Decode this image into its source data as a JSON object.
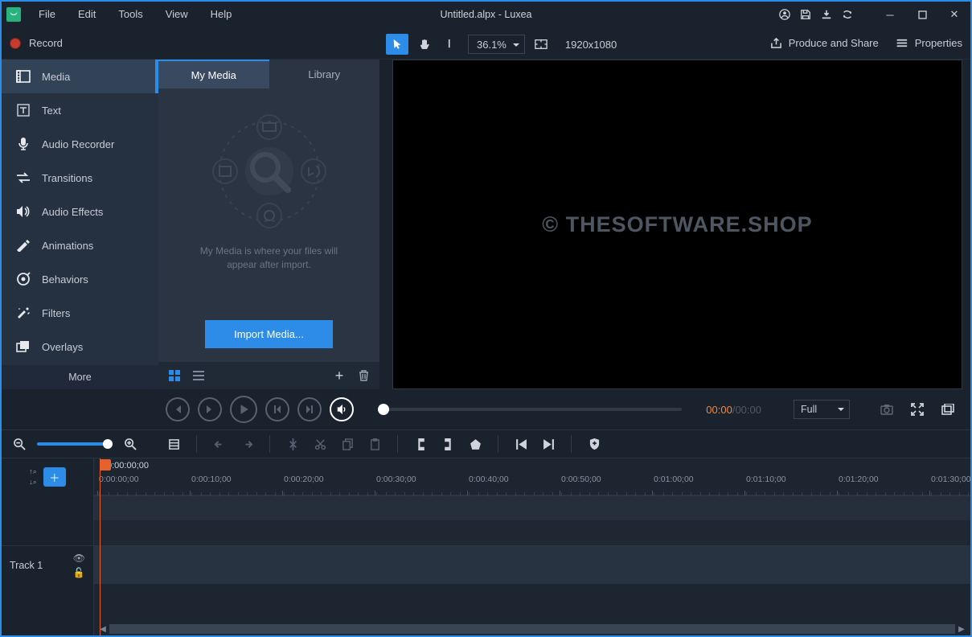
{
  "menu": {
    "file": "File",
    "edit": "Edit",
    "tools": "Tools",
    "view": "View",
    "help": "Help"
  },
  "title": "Untitled.alpx - Luxea",
  "record": "Record",
  "zoom": "36.1%",
  "resolution": "1920x1080",
  "produce": "Produce and Share",
  "properties": "Properties",
  "side": {
    "media": "Media",
    "text": "Text",
    "audio_rec": "Audio Recorder",
    "transitions": "Transitions",
    "audio_fx": "Audio Effects",
    "animations": "Animations",
    "behaviors": "Behaviors",
    "filters": "Filters",
    "overlays": "Overlays",
    "more": "More"
  },
  "media_tabs": {
    "mymedia": "My Media",
    "library": "Library"
  },
  "media_hint_1": "My Media is where your files will",
  "media_hint_2": "appear after import.",
  "import_btn": "Import Media...",
  "watermark": "© THESOFTWARE.SHOP",
  "timecode_cur": "00:00",
  "timecode_dur": "/00:00",
  "view_mode": "Full",
  "ruler_start": "0:00:00;00",
  "ticks": [
    "0:00:00;00",
    "0:00:10;00",
    "0:00:20;00",
    "0:00:30;00",
    "0:00:40;00",
    "0:00:50;00",
    "0:01:00;00",
    "0:01:10;00",
    "0:01:20;00",
    "0:01:30;00"
  ],
  "track1": "Track 1"
}
